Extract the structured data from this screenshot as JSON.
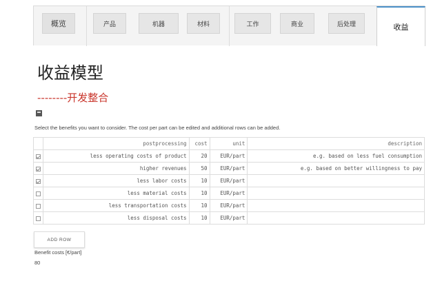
{
  "tabs": [
    {
      "label": "概览"
    },
    {
      "label": "产品"
    },
    {
      "label": "机器"
    },
    {
      "label": "材料"
    },
    {
      "label": "工作"
    },
    {
      "label": "商业"
    },
    {
      "label": "后处理"
    },
    {
      "label": "收益"
    }
  ],
  "page": {
    "title": "收益模型",
    "subtitle": "--------开发整合"
  },
  "instructions": "Select the benefits you want to consider. The cost per part can be edited and additional rows can be added.",
  "table": {
    "headers": [
      "postprocessing",
      "cost",
      "unit",
      "description"
    ],
    "rows": [
      {
        "checked": true,
        "name": "less operating costs of product",
        "cost": "20",
        "unit": "EUR/part",
        "description": "e.g. based on less fuel consumption"
      },
      {
        "checked": true,
        "name": "higher revenues",
        "cost": "50",
        "unit": "EUR/part",
        "description": "e.g. based on better willingness to pay"
      },
      {
        "checked": true,
        "name": "less labor costs",
        "cost": "10",
        "unit": "EUR/part",
        "description": ""
      },
      {
        "checked": false,
        "name": "less material costs",
        "cost": "10",
        "unit": "EUR/part",
        "description": ""
      },
      {
        "checked": false,
        "name": "less transportation costs",
        "cost": "10",
        "unit": "EUR/part",
        "description": ""
      },
      {
        "checked": false,
        "name": "less disposal costs",
        "cost": "10",
        "unit": "EUR/part",
        "description": ""
      }
    ]
  },
  "add_row_label": "ADD ROW",
  "benefit": {
    "label": "Benefit costs [€/part]",
    "value": "80"
  }
}
